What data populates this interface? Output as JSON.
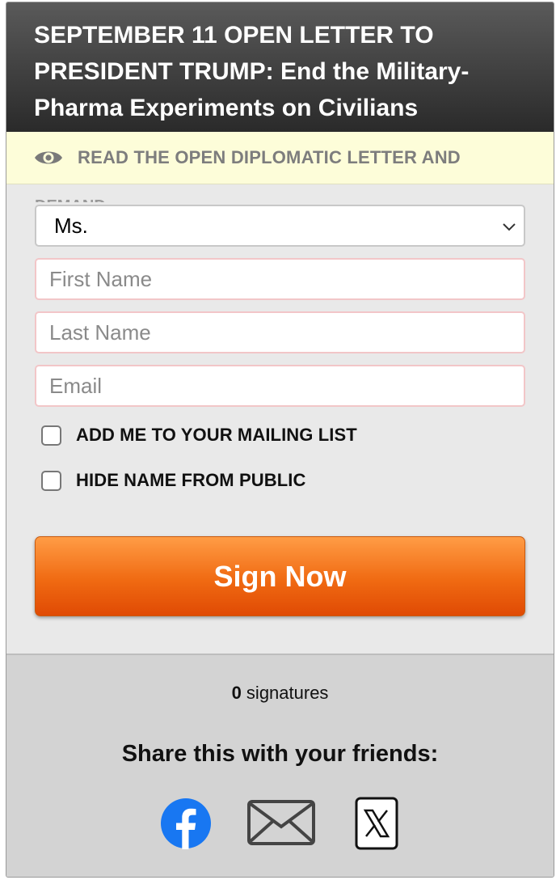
{
  "header": {
    "title": "SEPTEMBER 11 OPEN LETTER TO PRESIDENT TRUMP: End the Military-Pharma Experiments on Civilians"
  },
  "notice": {
    "text": "READ THE OPEN DIPLOMATIC LETTER AND",
    "icon": "eye-icon"
  },
  "form": {
    "demand_peek": "DEMAND",
    "salutation": {
      "selected": "Ms."
    },
    "first_name": {
      "value": "",
      "placeholder": "First Name"
    },
    "last_name": {
      "value": "",
      "placeholder": "Last Name"
    },
    "email": {
      "value": "",
      "placeholder": "Email"
    },
    "mailing_list": {
      "label": "ADD ME TO YOUR MAILING LIST",
      "checked": false
    },
    "hide_name": {
      "label": "HIDE NAME FROM PUBLIC",
      "checked": false
    },
    "submit_label": "Sign Now"
  },
  "footer": {
    "signature_count": "0",
    "signature_suffix": " signatures",
    "share_title": "Share this with your friends:",
    "share_icons": [
      "facebook-icon",
      "mail-icon",
      "x-icon"
    ]
  },
  "colors": {
    "header_bg": "#2f2f2f",
    "notice_bg": "#fdfdd9",
    "button_orange": "#f06a12",
    "facebook_blue": "#1877f2"
  }
}
